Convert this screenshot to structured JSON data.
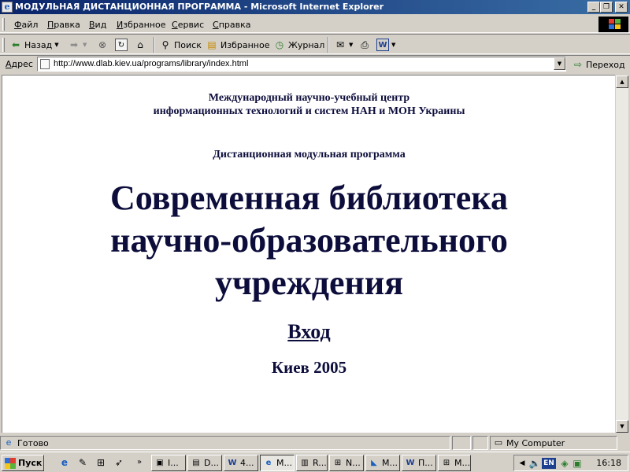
{
  "window": {
    "title": "МОДУЛЬНАЯ ДИСТАНЦИОННАЯ ПРОГРАММА - Microsoft Internet Explorer",
    "minimize_icon": "minimize-icon",
    "maximize_icon": "restore-icon",
    "close_icon": "close-icon"
  },
  "menu": {
    "items": [
      "Файл",
      "Правка",
      "Вид",
      "Избранное",
      "Сервис",
      "Справка"
    ]
  },
  "toolbar": {
    "back_label": "Назад",
    "search_label": "Поиск",
    "favorites_label": "Избранное",
    "history_label": "Журнал"
  },
  "address": {
    "label": "Адрес",
    "url": "http://www.dlab.kiev.ua/programs/library/index.html",
    "go_label": "Переход"
  },
  "page": {
    "institute_line1": "Международный научно-учебный центр",
    "institute_line2": "информационных технологий и систем НАН и МОН Украины",
    "program": "Дистанционная модульная программа",
    "title_line1": "Современная библиотека",
    "title_line2": "научно-образовательного",
    "title_line3": "учреждения",
    "enter_link": "Вход",
    "city_year": "Киев  2005"
  },
  "status": {
    "text": "Готово",
    "zone": "My Computer"
  },
  "taskbar": {
    "start_label": "Пуск",
    "tasks": [
      {
        "label": "I...",
        "icon": "window-icon"
      },
      {
        "label": "D...",
        "icon": "folder-icon"
      },
      {
        "label": "4...",
        "icon": "word-icon"
      },
      {
        "label": "М...",
        "icon": "ie-icon",
        "active": true
      },
      {
        "label": "R...",
        "icon": "document-icon"
      },
      {
        "label": "N...",
        "icon": "app-icon"
      },
      {
        "label": "М...",
        "icon": "app-icon"
      },
      {
        "label": "П...",
        "icon": "word-icon"
      },
      {
        "label": "М...",
        "icon": "app-icon"
      }
    ],
    "language": "EN",
    "clock": "16:18"
  }
}
